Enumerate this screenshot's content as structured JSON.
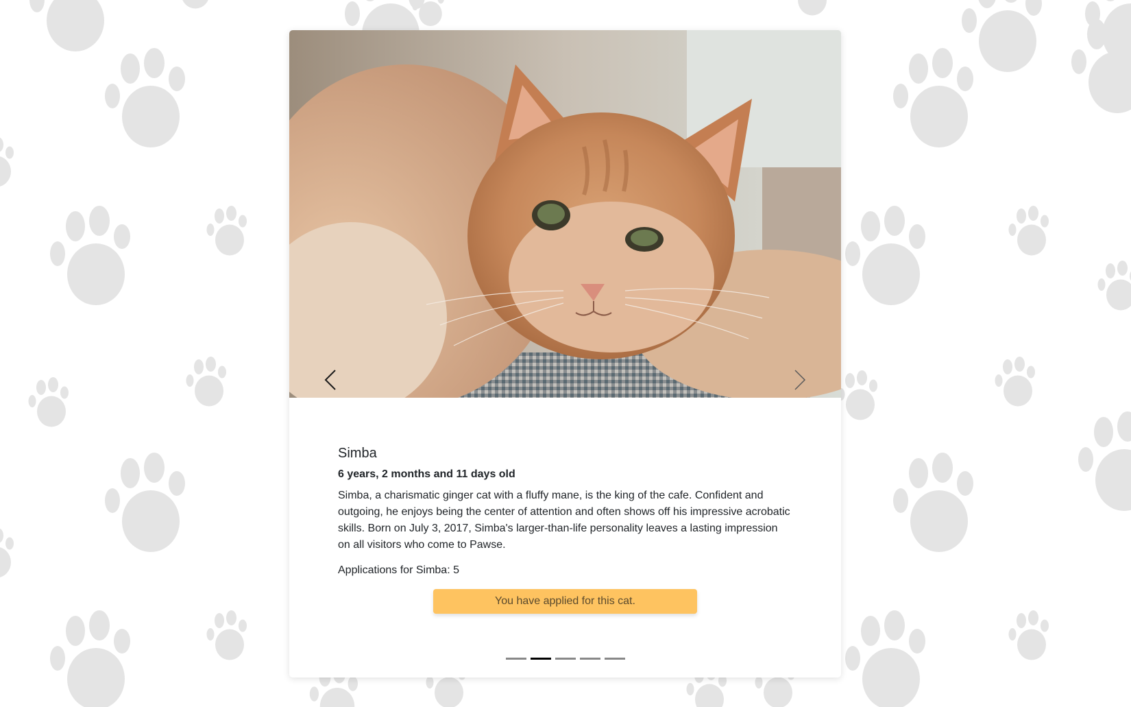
{
  "cat": {
    "name": "Simba",
    "age": "6 years, 2 months and 11 days old",
    "description": "Simba, a charismatic ginger cat with a fluffy mane, is the king of the cafe. Confident and outgoing, he enjoys being the center of attention and often shows off his impressive acrobatic skills. Born on July 3, 2017, Simba's larger-than-life personality leaves a lasting impression on all visitors who come to Pawse.",
    "applications": "Applications for Simba: 5"
  },
  "apply_button": {
    "label": "You have applied for this cat."
  },
  "carousel": {
    "slide_count": 5,
    "active_index": 1,
    "prev_icon": "chevron-left-icon",
    "next_icon": "chevron-right-icon"
  },
  "colors": {
    "apply_button_bg": "#fec360",
    "indicator_active": "#000000",
    "indicator_inactive": "#888888",
    "paw_print": "#e4e4e4"
  }
}
